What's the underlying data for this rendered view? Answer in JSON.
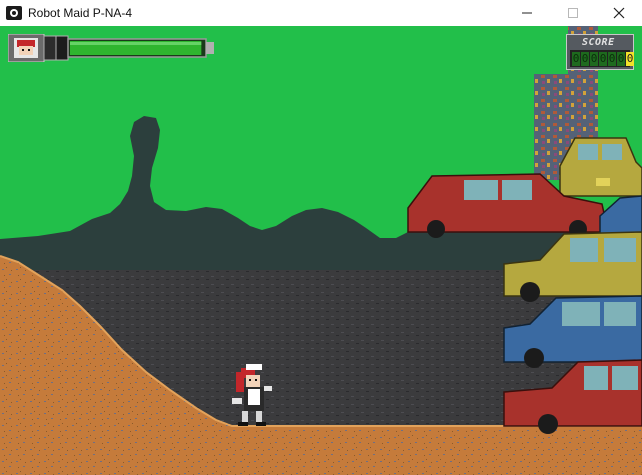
{
  "window": {
    "title": "Robot Maid P-NA-4"
  },
  "hud": {
    "score_label": "SCORE",
    "score_digits": [
      "0",
      "0",
      "0",
      "0",
      "0",
      "0",
      "0"
    ],
    "health_fraction": 0.98
  },
  "colors": {
    "sky": "#22bf4a",
    "mountain": "#2c3f3d",
    "ground": "#c57b3b",
    "pit": "#3b3b3d",
    "car_red": "#a8322c",
    "car_olive": "#b5a83f",
    "car_blue": "#3a6aa2"
  }
}
